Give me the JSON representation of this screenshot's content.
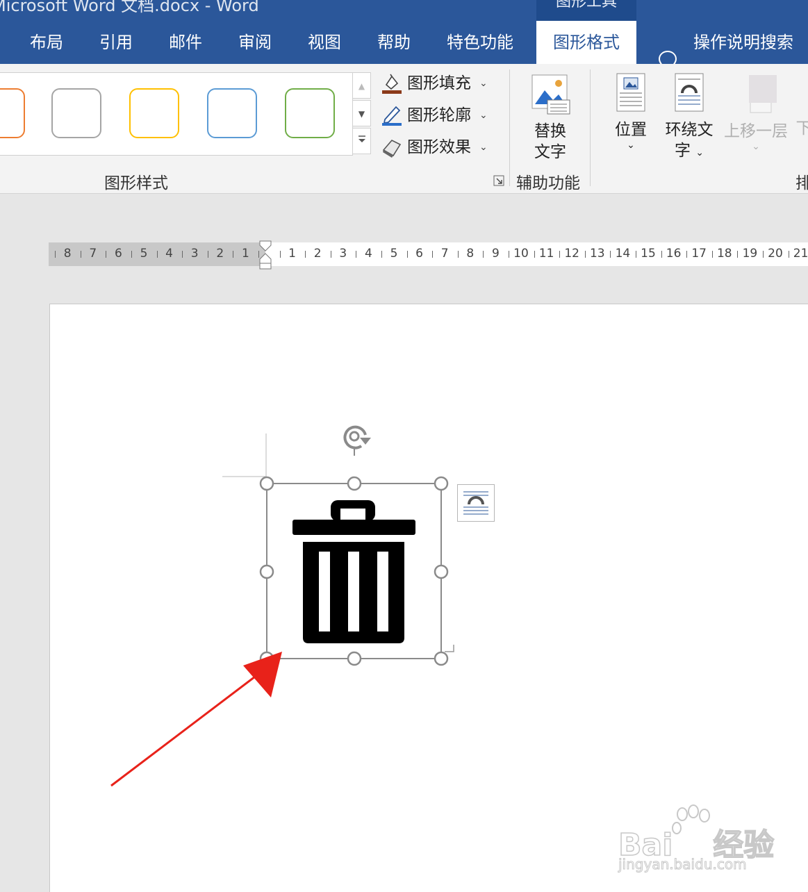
{
  "window": {
    "title": "Microsoft Word 文档.docx  -  Word",
    "context_tab_group": "图形工具"
  },
  "tabs": [
    {
      "label": "布局"
    },
    {
      "label": "引用"
    },
    {
      "label": "邮件"
    },
    {
      "label": "审阅"
    },
    {
      "label": "视图"
    },
    {
      "label": "帮助"
    },
    {
      "label": "特色功能"
    },
    {
      "label": "图形格式",
      "active": true
    }
  ],
  "tell_me": {
    "label": "操作说明搜索"
  },
  "ribbon": {
    "shape_styles": {
      "group_label": "图形样式",
      "swatch_colors": [
        "#ed7d31",
        "#a5a5a5",
        "#ffc000",
        "#5b9bd5",
        "#70ad47"
      ],
      "fill_label": "图形填充",
      "outline_label": "图形轮廓",
      "effects_label": "图形效果"
    },
    "accessibility": {
      "group_label": "辅助功能",
      "alt_text_line1": "替换",
      "alt_text_line2": "文字"
    },
    "arrange": {
      "position_label": "位置",
      "wrap_line1": "环绕文",
      "wrap_line2": "字",
      "bring_forward_label": "上移一层",
      "send_backward_label": "下",
      "group_label_partial": "排"
    }
  },
  "ruler": {
    "left_numbers": [
      "8",
      "7",
      "6",
      "5",
      "4",
      "3",
      "2",
      "1"
    ],
    "right_numbers": [
      "1",
      "2",
      "3",
      "4",
      "5",
      "6",
      "7",
      "8",
      "9",
      "10",
      "11",
      "12",
      "13",
      "14",
      "15",
      "16",
      "17",
      "18",
      "19",
      "20",
      "21"
    ]
  },
  "watermark": {
    "brand": "Bai",
    "brand2": "经验",
    "url": "jingyan.baidu.com"
  },
  "colors": {
    "accent": "#2b579a",
    "arrow": "#e8221a"
  }
}
